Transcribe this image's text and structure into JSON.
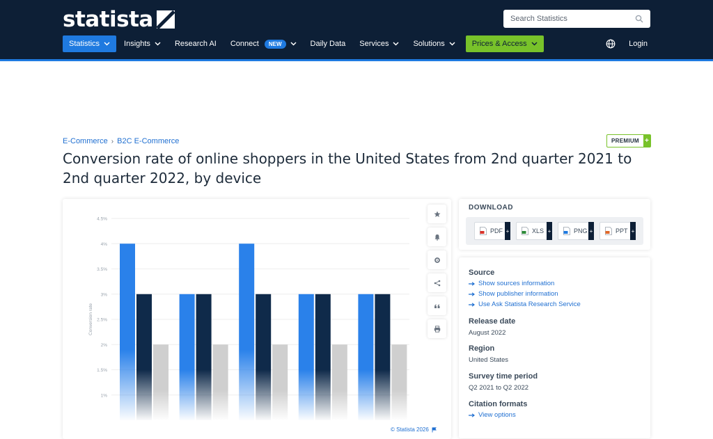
{
  "header": {
    "logo_text": "statista",
    "search_placeholder": "Search Statistics",
    "nav": [
      {
        "label": "Statistics"
      },
      {
        "label": "Insights"
      },
      {
        "label": "Research AI"
      },
      {
        "label": "Connect",
        "badge": "NEW"
      },
      {
        "label": "Daily Data"
      },
      {
        "label": "Services"
      },
      {
        "label": "Solutions"
      },
      {
        "label": "Prices & Access"
      }
    ],
    "login_label": "Login",
    "colors": {
      "navy": "#0d1f36",
      "accent": "#1f7ae0",
      "green": "#78c22a"
    }
  },
  "breadcrumb": [
    "E-Commerce",
    "B2C E-Commerce"
  ],
  "premium": {
    "label": "PREMIUM",
    "plus": "+"
  },
  "title": "Conversion rate of online shoppers in the United States from 2nd quarter 2021 to 2nd quarter 2022, by device",
  "tools": [
    "star-icon",
    "bell-icon",
    "gear-icon",
    "share-icon",
    "quote-icon",
    "print-icon"
  ],
  "copyright": "© Statista 2026",
  "download": {
    "label": "DOWNLOAD",
    "formats": [
      {
        "label": "PDF",
        "color": "#d9342b"
      },
      {
        "label": "XLS",
        "color": "#2e8b3a"
      },
      {
        "label": "PNG",
        "color": "#1f7ae0"
      },
      {
        "label": "PPT",
        "color": "#e0692b"
      }
    ],
    "plus": "+"
  },
  "info": {
    "source_heading": "Source",
    "source_links": [
      "Show sources information",
      "Show publisher information",
      "Use Ask Statista Research Service"
    ],
    "release_heading": "Release date",
    "release_value": "August 2022",
    "region_heading": "Region",
    "region_value": "United States",
    "period_heading": "Survey time period",
    "period_value": "Q2 2021 to Q2 2022",
    "citation_heading": "Citation formats",
    "citation_link": "View options"
  },
  "chart_data": {
    "type": "bar",
    "ylabel": "Conversion rate",
    "yticks": [
      "1%",
      "1.5%",
      "2%",
      "2.5%",
      "3%",
      "3.5%",
      "4%",
      "4.5%"
    ],
    "ylim": [
      0.5,
      4.5
    ],
    "grid": true,
    "categories": [
      "",
      "",
      "",
      "",
      ""
    ],
    "series": [
      {
        "values": [
          4,
          3,
          4,
          3,
          3
        ],
        "color": "#2a81ea"
      },
      {
        "values": [
          3,
          3,
          3,
          3,
          3
        ],
        "color": "#0f2a4a"
      },
      {
        "values": [
          2,
          2,
          2,
          2,
          2
        ],
        "color": "#cfcfcf"
      }
    ]
  }
}
